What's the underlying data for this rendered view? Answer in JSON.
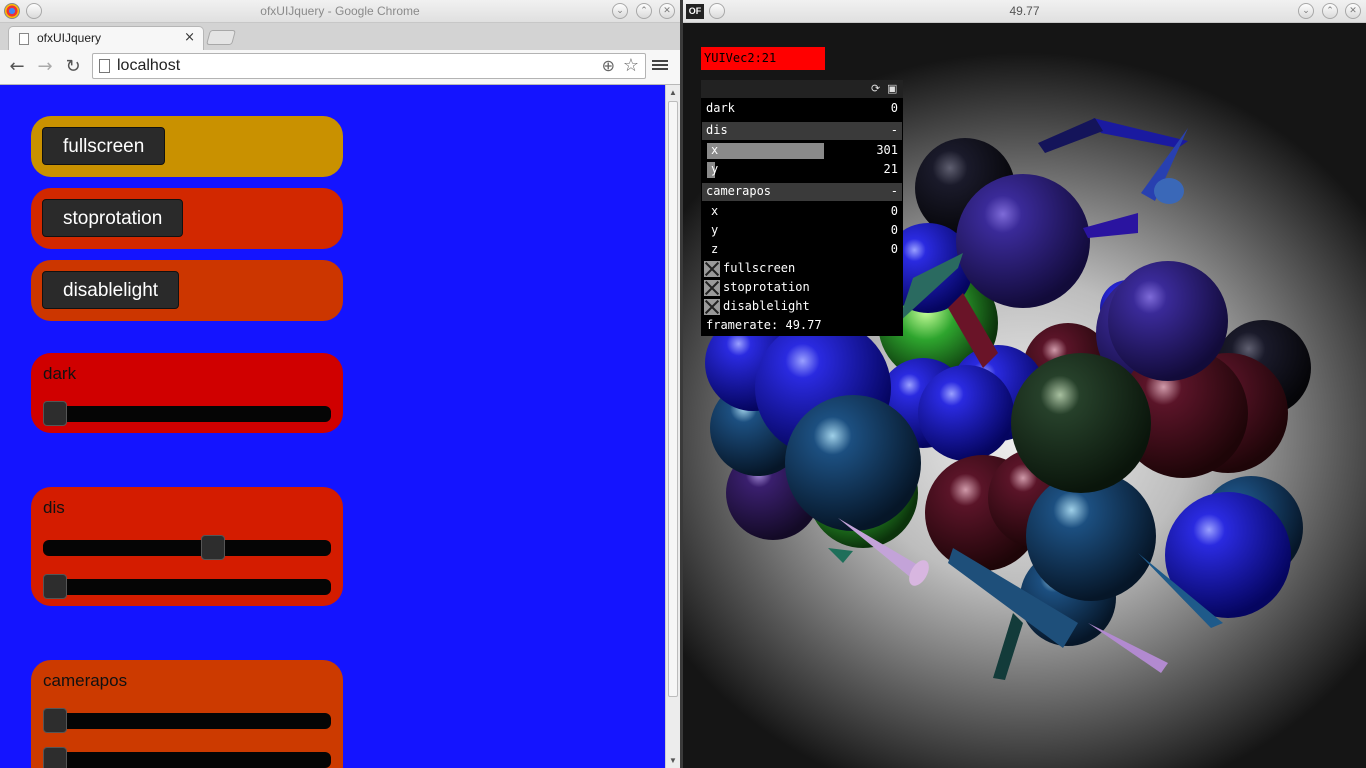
{
  "chrome": {
    "window_title": "ofxUIJquery - Google Chrome",
    "tab_label": "ofxUIJquery",
    "tab_close": "×",
    "url": "localhost",
    "back": "←",
    "forward": "→",
    "reload": "↻",
    "zoom_glyph": "⊕",
    "star_glyph": "☆"
  },
  "page": {
    "buttons": [
      {
        "label": "fullscreen",
        "color": "#c99100"
      },
      {
        "label": "stoprotation",
        "color": "#d22800"
      },
      {
        "label": "disablelight",
        "color": "#cc3600"
      }
    ],
    "sliders": {
      "dark": {
        "title": "dark",
        "color": "#d00000",
        "values": [
          0
        ]
      },
      "dis": {
        "title": "dis",
        "color": "#d41c00",
        "values": [
          0.6,
          0.0
        ]
      },
      "camerapos": {
        "title": "camerapos",
        "color": "#cc3a00",
        "values": [
          0.0,
          0.0
        ]
      }
    }
  },
  "of_window": {
    "title": "49.77",
    "logo": "OF",
    "message": "YUIVec2:21",
    "gui": {
      "rows": {
        "dark": {
          "label": "dark",
          "value": "0"
        },
        "dis": {
          "label": "dis",
          "collapse": "-"
        },
        "dis_x": {
          "label": "x",
          "value": "301",
          "fill": 0.6
        },
        "dis_y": {
          "label": "y",
          "value": "21",
          "fill": 0.04
        },
        "camerapos": {
          "label": "camerapos",
          "collapse": "-"
        },
        "cam_x": {
          "label": "x",
          "value": "0"
        },
        "cam_y": {
          "label": "y",
          "value": "0"
        },
        "cam_z": {
          "label": "z",
          "value": "0"
        },
        "fullscreen": {
          "label": "fullscreen"
        },
        "stoprotation": {
          "label": "stoprotation"
        },
        "disablelight": {
          "label": "disablelight"
        },
        "framerate": {
          "label": "framerate: 49.77"
        }
      }
    }
  },
  "icons": {
    "minimize": "⌄",
    "maximize": "⌃",
    "close": "✕",
    "refresh": "⟳",
    "save": "▣"
  }
}
